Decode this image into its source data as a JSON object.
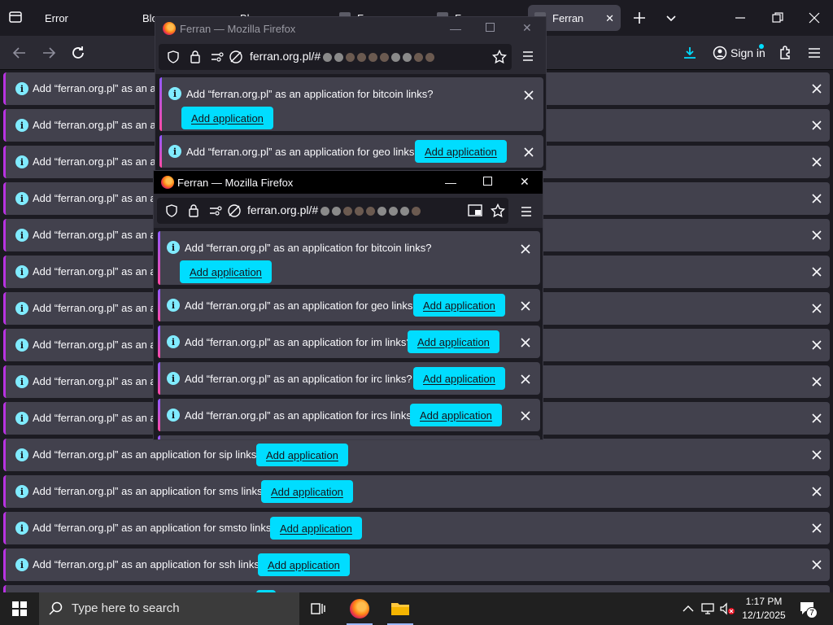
{
  "main": {
    "tabs": [
      {
        "label": "Error"
      },
      {
        "label": "Blo"
      },
      {
        "label": "Blo"
      },
      {
        "label": "F"
      },
      {
        "label": "F"
      },
      {
        "label": "Ferran",
        "active": true
      }
    ],
    "signin": "Sign in",
    "notification_prefix": "Add “ferran.org.pl” as an app",
    "notifications_truncated": 10,
    "notifications_full": [
      {
        "message": "Add “ferran.org.pl” as an application for sip links?"
      },
      {
        "message": "Add “ferran.org.pl” as an application for sms links?"
      },
      {
        "message": "Add “ferran.org.pl” as an application for smsto links?"
      },
      {
        "message": "Add “ferran.org.pl” as an application for ssh links?"
      }
    ],
    "add_button": "Add application"
  },
  "popup1": {
    "title": "Ferran — Mozilla Firefox",
    "url": "ferran.org.pl/#",
    "notifications": [
      {
        "message": "Add “ferran.org.pl” as an application for bitcoin links?"
      },
      {
        "message": "Add “ferran.org.pl” as an application for geo links?"
      }
    ]
  },
  "popup2": {
    "title": "Ferran — Mozilla Firefox",
    "url": "ferran.org.pl/#",
    "notifications": [
      {
        "message": "Add “ferran.org.pl” as an application for bitcoin links?"
      },
      {
        "message": "Add “ferran.org.pl” as an application for geo links?"
      },
      {
        "message": "Add “ferran.org.pl” as an application for im links?"
      },
      {
        "message": "Add “ferran.org.pl” as an application for irc links?"
      },
      {
        "message": "Add “ferran.org.pl” as an application for ircs links?"
      }
    ]
  },
  "taskbar": {
    "search_placeholder": "Type here to search",
    "time": "1:17 PM",
    "date": "12/1/2025",
    "notification_count": "7"
  },
  "colors": {
    "accent": "#00ddff",
    "info": "#80ebff",
    "panel": "#42414d",
    "bg": "#1c1b22"
  }
}
